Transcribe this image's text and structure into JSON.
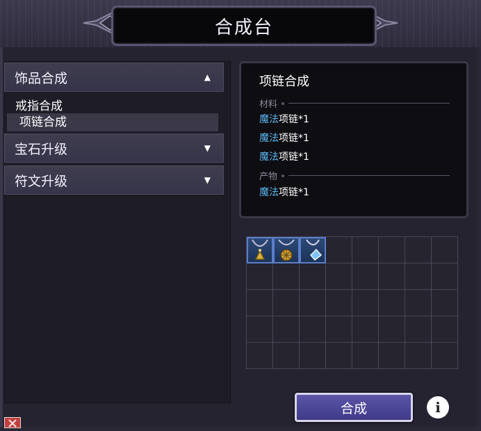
{
  "window": {
    "title": "合成台"
  },
  "categories": [
    {
      "label": "饰品合成",
      "arrow": "▲",
      "expanded": true,
      "items": [
        {
          "label": "戒指合成",
          "selected": false
        },
        {
          "label": "项链合成",
          "selected": true
        }
      ]
    },
    {
      "label": "宝石升级",
      "arrow": "▼",
      "expanded": false
    },
    {
      "label": "符文升级",
      "arrow": "▼",
      "expanded": false
    }
  ],
  "recipe": {
    "title": "项链合成",
    "materials_label": "材料",
    "materials": [
      {
        "prefix": "魔法",
        "name": "项链*1"
      },
      {
        "prefix": "魔法",
        "name": "项链*1"
      },
      {
        "prefix": "魔法",
        "name": "项链*1"
      }
    ],
    "product_label": "产物",
    "product": {
      "prefix": "魔法",
      "name": "项链*1"
    },
    "prefix_color": "#5ab8f0"
  },
  "inventory": {
    "rows": 5,
    "cols": 8,
    "items": [
      {
        "icon": "bell-necklace-icon"
      },
      {
        "icon": "round-pendant-necklace-icon"
      },
      {
        "icon": "crystal-necklace-icon"
      }
    ]
  },
  "actions": {
    "synthesize_label": "合成",
    "info_label": "i"
  },
  "colors": {
    "accent": "#5c55a8",
    "slot_filled": "#2c4a78",
    "close": "#c0403e"
  }
}
